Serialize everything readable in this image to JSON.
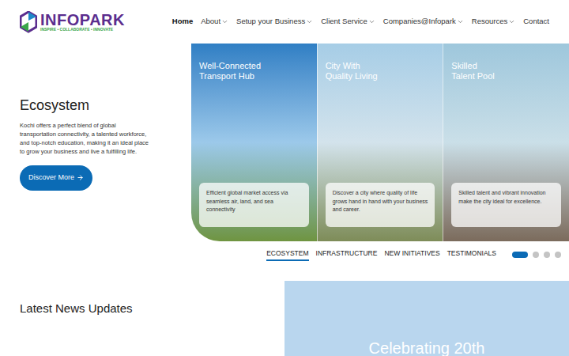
{
  "header": {
    "logo": {
      "name": "INFOPARK",
      "tagline": "INSPIRE • COLLABORATE • INNOVATE"
    },
    "nav": [
      {
        "label": "Home",
        "selected": true,
        "dropdown": false
      },
      {
        "label": "About",
        "selected": false,
        "dropdown": true
      },
      {
        "label": "Setup your Business",
        "selected": false,
        "dropdown": true
      },
      {
        "label": "Client Service",
        "selected": false,
        "dropdown": true
      },
      {
        "label": "Companies@Infopark",
        "selected": false,
        "dropdown": true
      },
      {
        "label": "Resources",
        "selected": false,
        "dropdown": true
      },
      {
        "label": "Contact",
        "selected": false,
        "dropdown": false
      }
    ]
  },
  "hero": {
    "title": "Ecosystem",
    "description": "Kochi offers a perfect blend of global transportation connectivity, a talented workforce, and top-notch education, making it an ideal place to grow your business and live a fulfilling life.",
    "button": "Discover More"
  },
  "panels": [
    {
      "title_lines": [
        "Well-Connected",
        "Transport Hub"
      ],
      "text": "Efficient global market access via seamless air, land, and sea connectivity"
    },
    {
      "title_lines": [
        "City With",
        "Quality Living"
      ],
      "text": "Discover a city where quality of life grows hand in hand with your business and career."
    },
    {
      "title_lines": [
        "Skilled",
        "Talent Pool"
      ],
      "text": "Skilled talent and vibrant innovation make the city ideal for excellence."
    }
  ],
  "tabs": [
    {
      "label": "ECOSYSTEM",
      "selected": true
    },
    {
      "label": "INFRASTRUCTURE",
      "selected": false
    },
    {
      "label": "NEW INITIATIVES",
      "selected": false
    },
    {
      "label": "TESTIMONIALS",
      "selected": false
    }
  ],
  "carousel_dots": [
    {
      "selected": true
    },
    {
      "selected": false
    },
    {
      "selected": false
    },
    {
      "selected": false
    }
  ],
  "news": {
    "title": "Latest News Updates",
    "banner": "Celebrating 20th"
  }
}
